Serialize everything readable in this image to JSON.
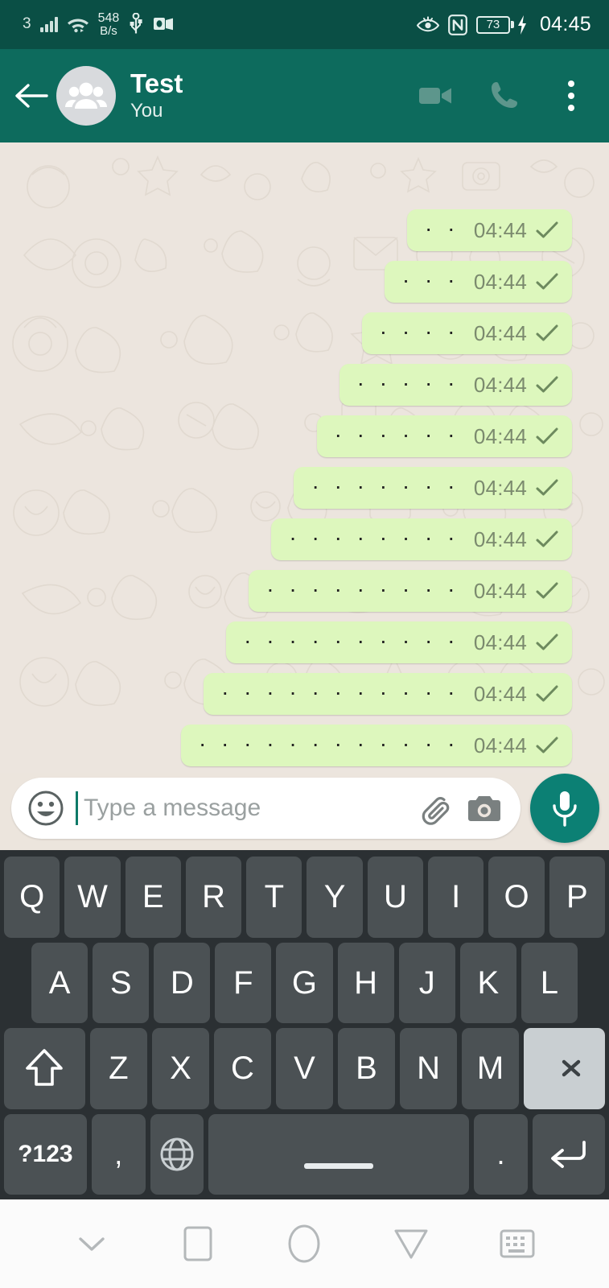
{
  "status_bar": {
    "network_label": "3",
    "data_speed_value": "548",
    "data_speed_unit": "B/s",
    "battery_level": "73",
    "clock": "04:45",
    "icons": [
      "signal-bars-icon",
      "wifi-icon",
      "usb-icon",
      "outlook-icon",
      "eye-comfort-icon",
      "nfc-icon",
      "battery-charging-icon"
    ],
    "background_color": "#0a4f45"
  },
  "header": {
    "title": "Test",
    "subtitle": "You",
    "background_color": "#0d6b5d",
    "icons": [
      "back-arrow-icon",
      "group-avatar-icon",
      "video-call-icon",
      "voice-call-icon",
      "overflow-menu-icon"
    ]
  },
  "chat": {
    "bubble_color": "#ddf7bd",
    "wallpaper_color": "#ece5de",
    "messages": [
      {
        "text": "· ·",
        "time": "04:44",
        "status": "sent"
      },
      {
        "text": "· · ·",
        "time": "04:44",
        "status": "sent"
      },
      {
        "text": "· · · ·",
        "time": "04:44",
        "status": "sent"
      },
      {
        "text": "· · · · ·",
        "time": "04:44",
        "status": "sent"
      },
      {
        "text": "· · · · · ·",
        "time": "04:44",
        "status": "sent"
      },
      {
        "text": "· · · · · · ·",
        "time": "04:44",
        "status": "sent"
      },
      {
        "text": "· · · · · · · ·",
        "time": "04:44",
        "status": "sent"
      },
      {
        "text": "· · · · · · · · ·",
        "time": "04:44",
        "status": "sent"
      },
      {
        "text": "· · · · · · · · · ·",
        "time": "04:44",
        "status": "sent"
      },
      {
        "text": "· · · · · · · · · · ·",
        "time": "04:44",
        "status": "sent"
      },
      {
        "text": "· · · · · · · · · · · ·",
        "time": "04:44",
        "status": "sent"
      }
    ]
  },
  "input_bar": {
    "placeholder": "Type a message",
    "value": "",
    "icons": [
      "emoji-icon",
      "attach-icon",
      "camera-icon",
      "mic-icon"
    ],
    "mic_button_color": "#0c8074"
  },
  "keyboard": {
    "row1": [
      "Q",
      "W",
      "E",
      "R",
      "T",
      "Y",
      "U",
      "I",
      "O",
      "P"
    ],
    "row2": [
      "A",
      "S",
      "D",
      "F",
      "G",
      "H",
      "J",
      "K",
      "L"
    ],
    "row3": [
      "Z",
      "X",
      "C",
      "V",
      "B",
      "N",
      "M"
    ],
    "shift_label": "",
    "backspace_label": "",
    "symbols_label": "?123",
    "comma_label": ",",
    "globe_label": "",
    "space_label": "",
    "period_label": ".",
    "enter_label": "",
    "key_color": "#4b5154",
    "background_color": "#2b3033"
  },
  "nav_bar": {
    "buttons": [
      "hide-keyboard-icon",
      "recents-icon",
      "home-icon",
      "back-icon",
      "switch-keyboard-icon"
    ]
  }
}
